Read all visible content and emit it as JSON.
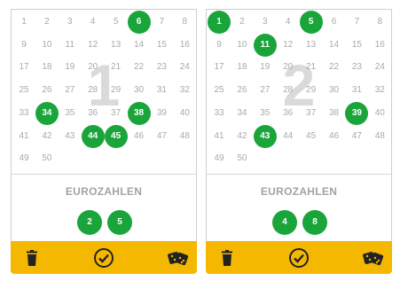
{
  "tickets": [
    {
      "index_label": "1",
      "numbers": [
        1,
        2,
        3,
        4,
        5,
        6,
        7,
        8,
        9,
        10,
        11,
        12,
        13,
        14,
        15,
        16,
        17,
        18,
        19,
        20,
        21,
        22,
        23,
        24,
        25,
        26,
        27,
        28,
        29,
        30,
        31,
        32,
        33,
        34,
        35,
        36,
        37,
        38,
        39,
        40,
        41,
        42,
        43,
        44,
        45,
        46,
        47,
        48,
        49,
        50
      ],
      "selected": [
        6,
        34,
        38,
        44,
        45
      ],
      "euro_title": "EUROZAHLEN",
      "euro_numbers": [
        "2",
        "5"
      ]
    },
    {
      "index_label": "2",
      "numbers": [
        1,
        2,
        3,
        4,
        5,
        6,
        7,
        8,
        9,
        10,
        11,
        12,
        13,
        14,
        15,
        16,
        17,
        18,
        19,
        20,
        21,
        22,
        23,
        24,
        25,
        26,
        27,
        28,
        29,
        30,
        31,
        32,
        33,
        34,
        35,
        36,
        37,
        38,
        39,
        40,
        41,
        42,
        43,
        44,
        45,
        46,
        47,
        48,
        49,
        50
      ],
      "selected": [
        1,
        5,
        11,
        39,
        43
      ],
      "euro_title": "EUROZAHLEN",
      "euro_numbers": [
        "4",
        "8"
      ]
    }
  ],
  "icons": {
    "delete": "trash-icon",
    "confirm": "check-circle-icon",
    "quick_pick": "dice-icon"
  },
  "colors": {
    "selected_green": "#1aa53b",
    "action_bar": "#f5b800",
    "unselected_number": "#a9a9a9"
  }
}
